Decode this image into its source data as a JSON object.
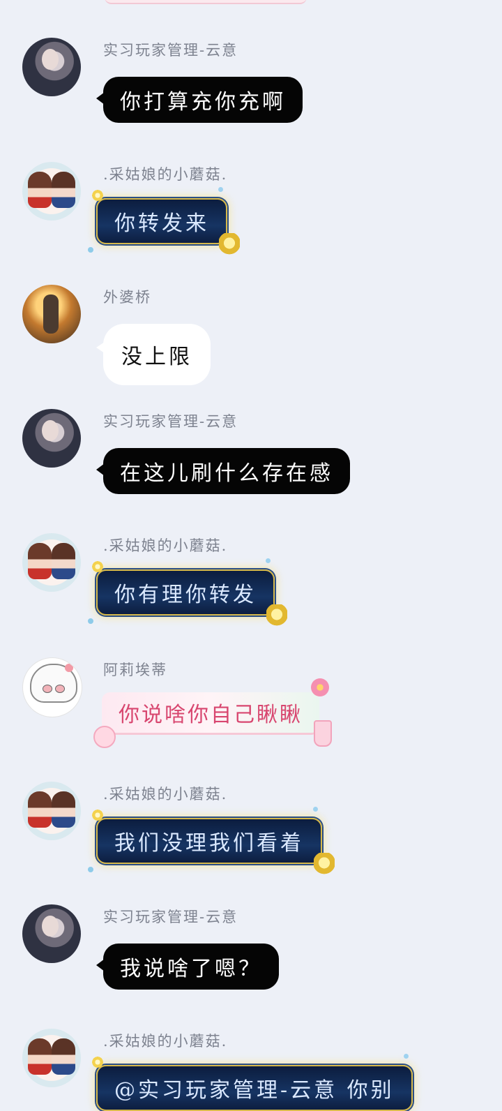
{
  "messages": [
    {
      "sender": "实习玩家管理-云意",
      "text": "你打算充你充啊",
      "style": "black",
      "avatar": "girl"
    },
    {
      "sender": ".采姑娘的小蘑菇.",
      "text": "你转发来",
      "style": "blue",
      "avatar": "duo"
    },
    {
      "sender": "外婆桥",
      "text": "没上限",
      "style": "white",
      "avatar": "warm"
    },
    {
      "sender": "实习玩家管理-云意",
      "text": "在这儿刷什么存在感",
      "style": "black",
      "avatar": "girl"
    },
    {
      "sender": ".采姑娘的小蘑菇.",
      "text": "你有理你转发",
      "style": "blue",
      "avatar": "duo"
    },
    {
      "sender": "阿莉埃蒂",
      "text": "你说啥你自己瞅瞅",
      "style": "pink",
      "avatar": "sketch"
    },
    {
      "sender": ".采姑娘的小蘑菇.",
      "text": "我们没理我们看着",
      "style": "blue",
      "avatar": "duo"
    },
    {
      "sender": "实习玩家管理-云意",
      "text": "我说啥了嗯？",
      "style": "black",
      "avatar": "girl"
    },
    {
      "sender": ".采姑娘的小蘑菇.",
      "text": "@实习玩家管理-云意 你别",
      "style": "blue",
      "avatar": "duo"
    }
  ]
}
